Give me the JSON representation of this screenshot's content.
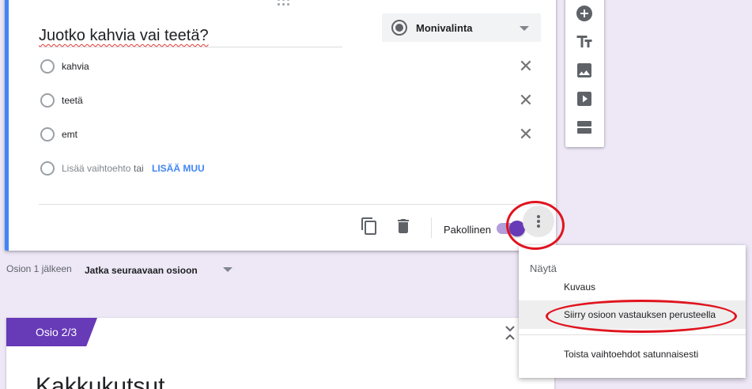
{
  "question": {
    "title": "Juotko kahvia vai teetä?",
    "type_label": "Monivalinta",
    "options": [
      {
        "label": "kahvia"
      },
      {
        "label": "teetä"
      },
      {
        "label": "emt"
      }
    ],
    "add_option_label": "Lisää vaihtoehto",
    "or_label": "tai",
    "add_other_label": "LISÄÄ MUU",
    "required_label": "Pakollinen",
    "required_on": true
  },
  "after_section": {
    "label": "Osion 1 jälkeen",
    "value": "Jatka seuraavaan osioon"
  },
  "section": {
    "tag": "Osio 2/3",
    "title": "Kakkukutsut"
  },
  "menu": {
    "heading": "Näytä",
    "items": [
      {
        "label": "Kuvaus"
      },
      {
        "label": "Siirry osioon vastauksen perusteella"
      },
      {
        "label": "Toista vaihtoehdot satunnaisesti"
      }
    ]
  },
  "colors": {
    "accent": "#673ab7",
    "link": "#4285f4",
    "annotation": "#e0141e",
    "background": "#ede7f6"
  },
  "icons": {
    "sidebar": [
      "add-question-icon",
      "add-title-icon",
      "add-image-icon",
      "add-video-icon",
      "add-section-icon"
    ],
    "footer": [
      "duplicate-icon",
      "delete-icon",
      "more-vert-icon"
    ]
  }
}
